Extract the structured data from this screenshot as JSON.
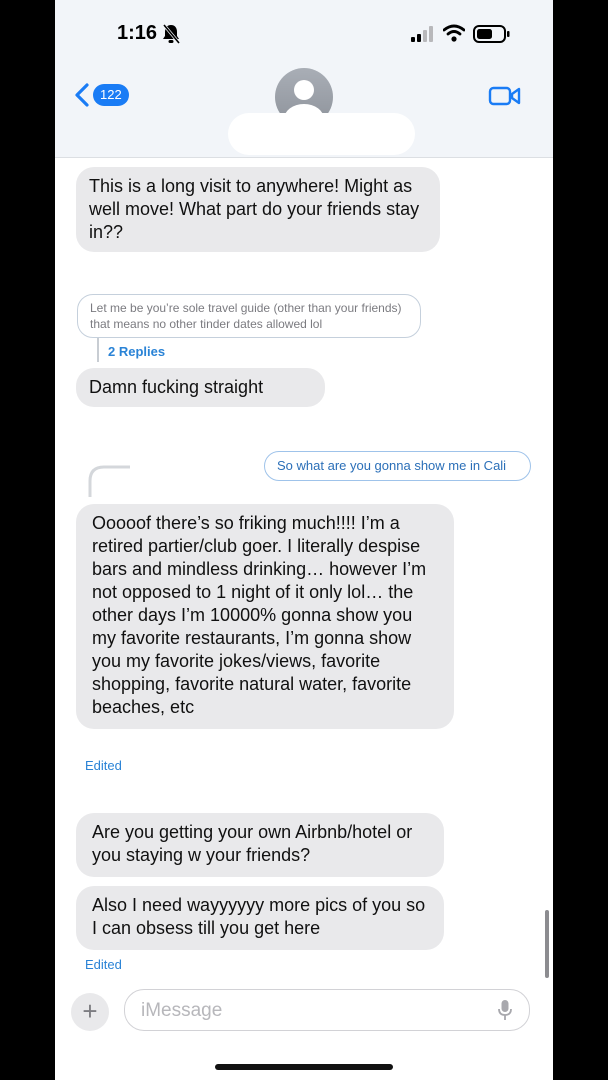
{
  "status_bar": {
    "time": "1:16"
  },
  "header": {
    "back_count": "122"
  },
  "messages": {
    "m1": "This is a long visit to anywhere! Might as well move! What part do your friends stay in??",
    "quoted": "Let me be you’re sole travel guide (other than your friends) that means no other tinder dates allowed lol",
    "replies": "2 Replies",
    "m2": "Damn fucking straight",
    "sent_quoted": "So what are you gonna show me in Cali",
    "m3": "Ooooof there’s so friking much!!!! I’m a retired partier/club goer. I literally despise bars and mindless drinking… however I’m not opposed to 1 night of it only lol… the other days I’m 10000% gonna show you my favorite restaurants, I’m gonna show you my favorite jokes/views, favorite shopping, favorite natural water, favorite beaches, etc",
    "edited_1": "Edited",
    "m4": "Are you getting your own Airbnb/hotel or you staying w your friends?",
    "m5": "Also I need wayyyyyy more pics of you so I can obsess till you get here",
    "edited_2": "Edited"
  },
  "compose": {
    "placeholder": "iMessage"
  },
  "colors": {
    "accent": "#1a7cf5",
    "bubble_received": "#e9e9eb"
  },
  "icons": [
    "bell-slash-icon",
    "signal-icon",
    "wifi-icon",
    "battery-icon",
    "chevron-left-icon",
    "video-camera-icon",
    "plus-icon",
    "microphone-icon"
  ]
}
